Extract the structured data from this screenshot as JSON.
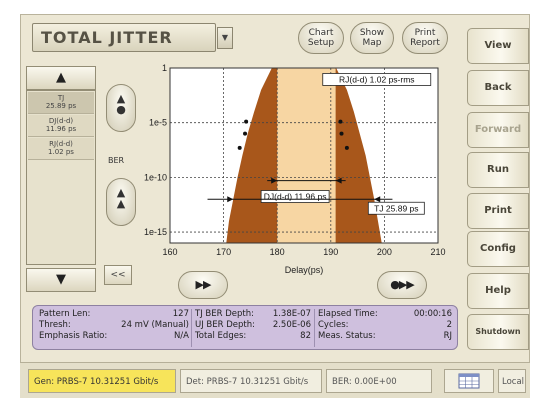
{
  "header": {
    "title": "TOTAL JITTER",
    "buttons": [
      {
        "line1": "Chart",
        "line2": "Setup"
      },
      {
        "line1": "Show",
        "line2": "Map"
      },
      {
        "line1": "Print",
        "line2": "Report"
      }
    ]
  },
  "rail": [
    "View",
    "Back",
    "Forward",
    "Run",
    "Print",
    "Config",
    "Help",
    "Shutdown"
  ],
  "list": [
    {
      "line1": "TJ",
      "line2": "25.89 ps"
    },
    {
      "line1": "DJ(d-d)",
      "line2": "11.96 ps"
    },
    {
      "line1": "RJ(d-d)",
      "line2": "1.02 ps"
    }
  ],
  "side": {
    "ber_label": "BER",
    "collapse_label": "<<",
    "up_arrow": "▲",
    "down_arrow": "▼",
    "prev_label": "▶▶",
    "next_label": "●▶▶"
  },
  "chart_data": {
    "type": "area",
    "xlabel": "Delay(ps)",
    "ylabel": "",
    "xlim": [
      160,
      210
    ],
    "x_ticks": [
      160,
      170,
      180,
      190,
      200,
      210
    ],
    "y_ticks": [
      "1",
      "1e-5",
      "1e-10",
      "1e-15"
    ],
    "bathtub_left_x": [
      170.5,
      171.0,
      171.8,
      172.6,
      173.5,
      174.5,
      175.7,
      177.0,
      179.0
    ],
    "bathtub_left_logber": [
      -16,
      -14,
      -12,
      -10,
      -8,
      -6,
      -4,
      -2,
      0
    ],
    "bathtub_right_x": [
      191.0,
      193.0,
      194.3,
      195.4,
      196.5,
      197.3,
      198.1,
      198.8,
      199.5
    ],
    "bathtub_right_logber": [
      0,
      -2,
      -4,
      -6,
      -8,
      -10,
      -12,
      -14,
      -16
    ],
    "dj_region": [
      180.0,
      190.9
    ],
    "measured_points": [
      {
        "x": 174.2,
        "logber": -4.9
      },
      {
        "x": 174.0,
        "logber": -6.0
      },
      {
        "x": 173.0,
        "logber": -7.3
      },
      {
        "x": 191.8,
        "logber": -4.9
      },
      {
        "x": 192.0,
        "logber": -6.0
      },
      {
        "x": 193.0,
        "logber": -7.3
      }
    ],
    "annotations": {
      "rj": "RJ(d-d) 1.02 ps-rms",
      "dj": "DJ(d-d) 11.96 ps",
      "tj": "TJ 25.89 ps"
    },
    "colors": {
      "outer": "#a8571b",
      "inner": "#f7d6a3",
      "plot_bg": "#ffffff",
      "grid": "#9a9a9a"
    }
  },
  "stats": {
    "pattern_len_label": "Pattern Len:",
    "pattern_len_value": "127",
    "thresh_label": "Thresh:",
    "thresh_value": "24 mV (Manual)",
    "emphasis_label": "Emphasis Ratio:",
    "emphasis_value": "N/A",
    "tj_ber_label": "TJ BER Depth:",
    "tj_ber_value": "1.38E-07",
    "uj_ber_label": "UJ BER Depth:",
    "uj_ber_value": "2.50E-06",
    "edges_label": "Total Edges:",
    "edges_value": "82",
    "elapsed_label": "Elapsed Time:",
    "elapsed_value": "00:00:16",
    "cycles_label": "Cycles:",
    "cycles_value": "2",
    "meas_label": "Meas. Status:",
    "meas_value": "RJ"
  },
  "statusbar": {
    "gen": "Gen: PRBS-7 10.31251 Gbit/s",
    "det": "Det: PRBS-7 10.31251 Gbit/s",
    "ber": "BER: 0.00E+00",
    "local": "Local"
  }
}
